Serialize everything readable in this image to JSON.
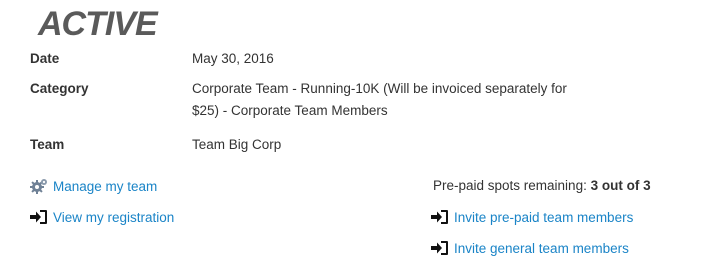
{
  "brand": {
    "logo_text": "ACTIVE"
  },
  "details": {
    "date": {
      "label": "Date",
      "value": "May 30, 2016"
    },
    "category": {
      "label": "Category",
      "value_line1": "Corporate Team - Running-10K (Will be invoiced separately for",
      "value_line2": "$25) - Corporate Team Members"
    },
    "team": {
      "label": "Team",
      "value": "Team Big Corp"
    }
  },
  "links": {
    "manage_team": {
      "label": "Manage my team",
      "icon": "gear-icon"
    },
    "view_registration": {
      "label": "View my registration",
      "icon": "sign-in-icon"
    },
    "invite_prepaid": {
      "label": "Invite pre-paid team members",
      "icon": "sign-in-icon"
    },
    "invite_general": {
      "label": "Invite general team members",
      "icon": "sign-in-icon"
    }
  },
  "spots": {
    "prefix": "Pre-paid spots remaining: ",
    "count": "3 out of 3"
  },
  "colors": {
    "link": "#1a84c7",
    "text": "#333333",
    "logo": "#5a5a5a"
  }
}
